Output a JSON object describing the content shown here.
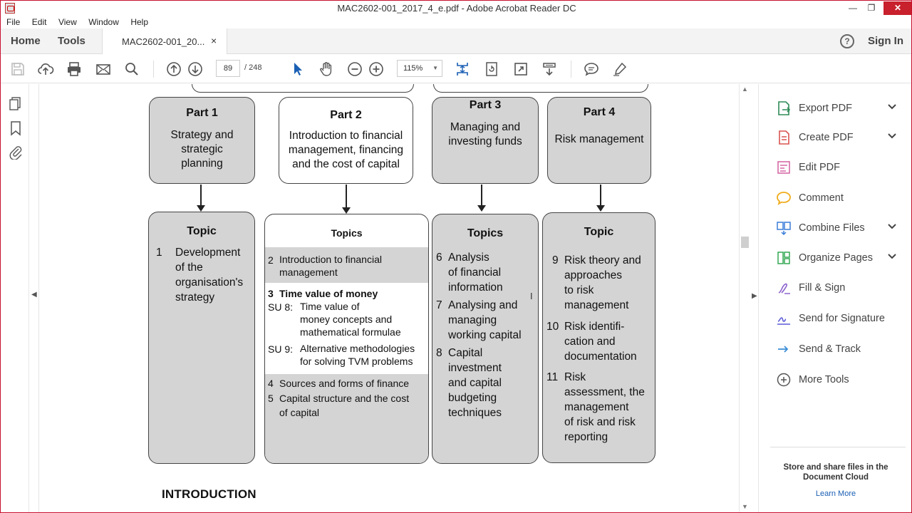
{
  "window": {
    "title": "MAC2602-001_2017_4_e.pdf - Adobe Acrobat Reader DC",
    "min": "—",
    "max": "❐",
    "close": "✕"
  },
  "menu": [
    "File",
    "Edit",
    "View",
    "Window",
    "Help"
  ],
  "tabs": {
    "home": "Home",
    "tools": "Tools",
    "doc_tab": "MAC2602-001_20...",
    "close": "×",
    "help": "?",
    "sign_in": "Sign In"
  },
  "toolbar": {
    "page_current": "89",
    "page_total": "/ 248",
    "zoom": "115%",
    "zoom_caret": "▼"
  },
  "document": {
    "parts": [
      {
        "heading": "Part 1",
        "text": [
          "Strategy and",
          "strategic",
          "planning"
        ]
      },
      {
        "heading": "Part 2",
        "text": [
          "Introduction to financial",
          "management, financing",
          "and the cost of capital"
        ]
      },
      {
        "heading": "Part 3",
        "text": [
          "Managing and",
          "investing funds"
        ]
      },
      {
        "heading": "Part 4",
        "text": [
          "Risk management"
        ]
      }
    ],
    "topic_boxes": {
      "p1": {
        "heading": "Topic",
        "items": [
          {
            "num": "1",
            "lines": [
              "Development",
              "of the",
              "organisation's",
              "strategy"
            ]
          }
        ]
      },
      "p2": {
        "heading": "Topics",
        "item2": {
          "num": "2",
          "lines": [
            "Introduction to financial",
            "management"
          ]
        },
        "item3": {
          "num": "3",
          "title": "Time value of money"
        },
        "su8": {
          "label": "SU 8:",
          "lines": [
            "Time value of",
            "money concepts and",
            "mathematical formulae"
          ]
        },
        "su9": {
          "label": "SU 9:",
          "lines": [
            "Alternative methodologies",
            "for solving TVM problems"
          ]
        },
        "item4": {
          "num": "4",
          "text": "Sources and forms of finance"
        },
        "item5": {
          "num": "5",
          "lines": [
            "Capital structure and the cost",
            "of capital"
          ]
        }
      },
      "p3": {
        "heading": "Topics",
        "items": [
          {
            "num": "6",
            "lines": [
              "Analysis",
              "of financial",
              "information"
            ]
          },
          {
            "num": "7",
            "lines": [
              "Analysing and",
              "managing",
              "working capital"
            ]
          },
          {
            "num": "8",
            "lines": [
              "Capital",
              "investment",
              "and capital",
              "budgeting",
              "techniques"
            ]
          }
        ]
      },
      "p4": {
        "heading": "Topic",
        "items": [
          {
            "num": "9",
            "lines": [
              "Risk theory and",
              "approaches",
              "to risk",
              "management"
            ]
          },
          {
            "num": "10",
            "lines": [
              "Risk identifi-",
              "cation and",
              "documentation"
            ]
          },
          {
            "num": "11",
            "lines": [
              "Risk",
              "assessment, the",
              "management",
              "of risk and risk",
              "reporting"
            ]
          }
        ]
      }
    },
    "section_heading": "INTRODUCTION"
  },
  "right_pane": {
    "tools": [
      {
        "label": "Export PDF",
        "icon": "export-pdf-icon",
        "chevron": true,
        "color": "#2e8b57"
      },
      {
        "label": "Create PDF",
        "icon": "create-pdf-icon",
        "chevron": true,
        "color": "#d9534f"
      },
      {
        "label": "Edit PDF",
        "icon": "edit-pdf-icon",
        "chevron": false,
        "color": "#d66aa6"
      },
      {
        "label": "Comment",
        "icon": "comment-icon",
        "chevron": false,
        "color": "#f0ad1e"
      },
      {
        "label": "Combine Files",
        "icon": "combine-files-icon",
        "chevron": true,
        "color": "#3b7dd8"
      },
      {
        "label": "Organize Pages",
        "icon": "organize-pages-icon",
        "chevron": true,
        "color": "#34a853"
      },
      {
        "label": "Fill & Sign",
        "icon": "fill-sign-icon",
        "chevron": false,
        "color": "#8e63ce"
      },
      {
        "label": "Send for Signature",
        "icon": "send-signature-icon",
        "chevron": false,
        "color": "#5a5ad6"
      },
      {
        "label": "Send & Track",
        "icon": "send-track-icon",
        "chevron": false,
        "color": "#3b8ed8"
      },
      {
        "label": "More Tools",
        "icon": "more-tools-icon",
        "chevron": false,
        "color": "#555555"
      }
    ],
    "chevron": "⌄",
    "store_text": "Store and share files in the Document Cloud",
    "learn_more": "Learn More"
  },
  "colors": {
    "accent_blue": "#1a5fb4",
    "box_gray": "#d4d4d4",
    "window_border": "#c8102e"
  }
}
